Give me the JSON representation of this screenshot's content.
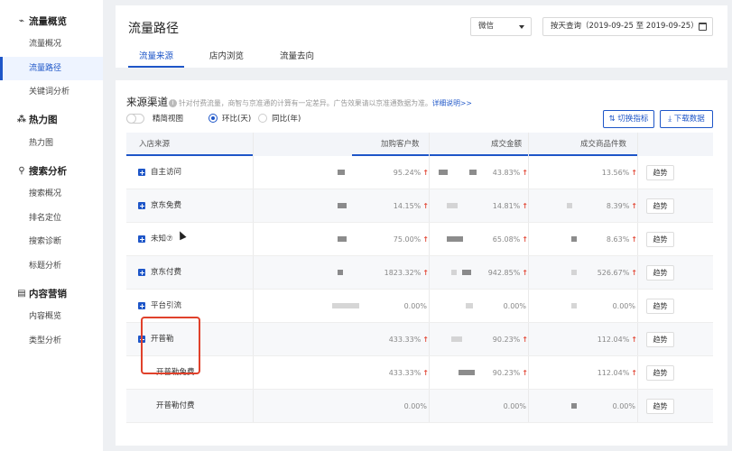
{
  "sidebar": {
    "sections": [
      {
        "title": "流量概览",
        "icon": "pulse-icon",
        "items": [
          "流量概况",
          "流量路径",
          "关键词分析"
        ]
      },
      {
        "title": "热力图",
        "icon": "heatmap-icon",
        "items": [
          "热力图"
        ]
      },
      {
        "title": "搜索分析",
        "icon": "search-icon",
        "items": [
          "搜索概况",
          "排名定位",
          "搜索诊断",
          "标题分析"
        ]
      },
      {
        "title": "内容营销",
        "icon": "document-icon",
        "items": [
          "内容概览",
          "类型分析"
        ]
      }
    ],
    "active_item": "流量路径"
  },
  "header": {
    "title": "流量路径",
    "channel_select": "微信",
    "date_range": "按天查询（2019-09-25 至 2019-09-25）",
    "tabs": [
      "流量来源",
      "店内浏览",
      "流量去向"
    ],
    "active_tab": "流量来源"
  },
  "section": {
    "title": "来源渠道",
    "description": "针对付费流量，商智与京准通的计算有一定差异。广告效果请以京准通数据为准。",
    "link": "详细说明>>",
    "toggle_label": "精简视图",
    "radio_ring": "环比(天)",
    "radio_yoy": "同比(年)",
    "btn_switch": "切换指标",
    "btn_download": "下载数据"
  },
  "table": {
    "headers": [
      "入店来源",
      "加购客户数",
      "成交金额",
      "成交商品件数"
    ],
    "trend_label": "趋势",
    "rows": [
      {
        "label": "自主访问",
        "c1": "95.24%",
        "c2": "43.83%",
        "c3": "13.56%",
        "a1": "↑",
        "a2": "↑",
        "a3": "↑",
        "expand": "plus"
      },
      {
        "label": "京东免费",
        "c1": "14.15%",
        "c2": "14.81%",
        "c3": "8.39%",
        "a1": "↑",
        "a2": "↑",
        "a3": "↑",
        "expand": "plus"
      },
      {
        "label": "未知⑦",
        "c1": "75.00%",
        "c2": "65.08%",
        "c3": "8.63%",
        "a1": "↑",
        "a2": "↑",
        "a3": "↑",
        "expand": "plus"
      },
      {
        "label": "京东付费",
        "c1": "1823.32%",
        "c2": "942.85%",
        "c3": "526.67%",
        "a1": "↑",
        "a2": "↑",
        "a3": "↑",
        "expand": "plus"
      },
      {
        "label": "平台引流",
        "c1": "0.00%",
        "c2": "0.00%",
        "c3": "0.00%",
        "a1": "",
        "a2": "",
        "a3": "",
        "expand": "plus"
      },
      {
        "label": "开普勒",
        "c1": "433.33%",
        "c2": "90.23%",
        "c3": "112.04%",
        "a1": "↑",
        "a2": "↑",
        "a3": "↑",
        "expand": "minus"
      },
      {
        "label": "开普勒免费",
        "c1": "433.33%",
        "c2": "90.23%",
        "c3": "112.04%",
        "a1": "↑",
        "a2": "↑",
        "a3": "↑",
        "expand": "none"
      },
      {
        "label": "开普勒付费",
        "c1": "0.00%",
        "c2": "0.00%",
        "c3": "0.00%",
        "a1": "",
        "a2": "",
        "a3": "",
        "expand": "none"
      }
    ]
  },
  "colors": {
    "accent": "#1e56c8",
    "up": "#e34d3c",
    "highlight": "#e0412b"
  }
}
